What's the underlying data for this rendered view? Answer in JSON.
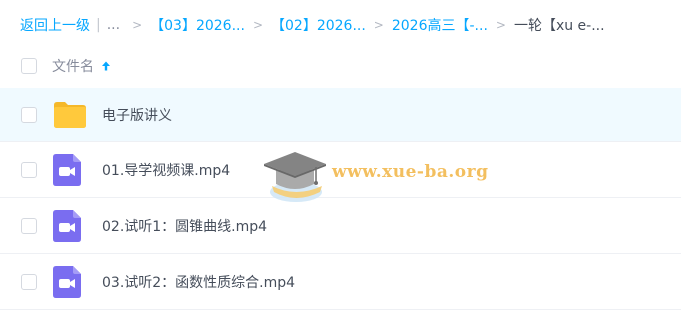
{
  "breadcrumb": {
    "back_label": "返回上一级",
    "ellipsis": "...",
    "separator": ">",
    "items": [
      "【03】2026...",
      "【02】2026...",
      "2026高三【-...",
      "一轮【xu e-..."
    ]
  },
  "header": {
    "filename_label": "文件名",
    "sort": "ascending"
  },
  "files": [
    {
      "name": "电子版讲义",
      "type": "folder"
    },
    {
      "name": "01.导学视频课.mp4",
      "type": "video"
    },
    {
      "name": "02.试听1：圆锥曲线.mp4",
      "type": "video"
    },
    {
      "name": "03.试听2：函数性质综合.mp4",
      "type": "video"
    }
  ],
  "watermark": {
    "text": "www.xue-ba.org"
  },
  "colors": {
    "accent": "#06a7ff",
    "folder": "#ffc93c",
    "video_icon": "#7a6df0",
    "row_highlight": "#f0faff"
  },
  "icons": {
    "folder": "folder-icon",
    "video": "video-file-icon",
    "sort": "arrow-up-icon",
    "watermark": "graduation-cap-icon"
  }
}
